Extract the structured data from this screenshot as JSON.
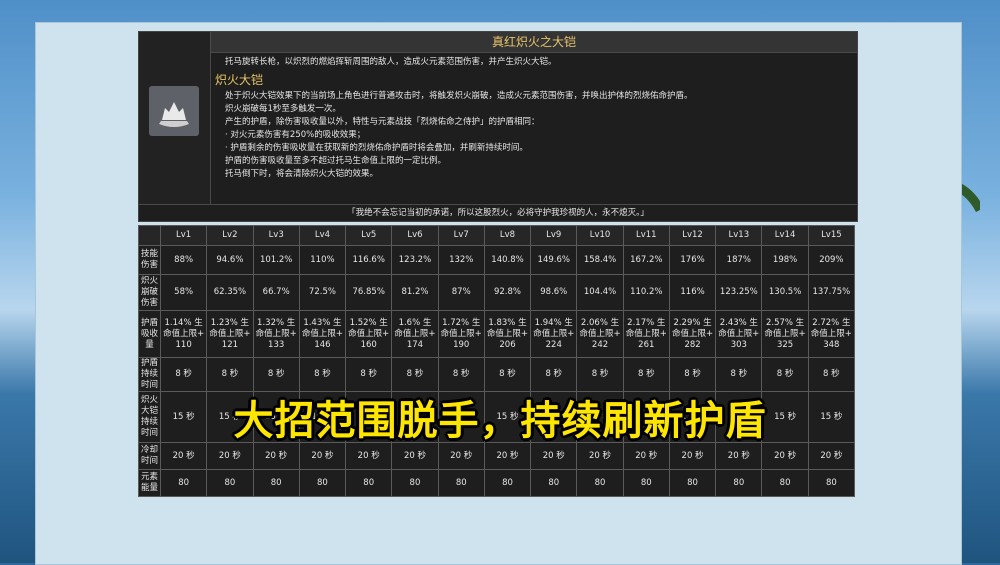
{
  "skill": {
    "name": "真红炽火之大铠",
    "intro": "托马旋转长枪，以炽烈的燃焰挥斩周围的敌人，造成火元素范围伤害，并产生炽火大铠。",
    "sub_title": "炽火大铠",
    "lines": [
      "处于炽火大铠效果下的当前场上角色进行普通攻击时，将触发炽火崩破，造成火元素范围伤害，并唤出护体的烈烧佑命护盾。",
      "炽火崩破每1秒至多触发一次。",
      "产生的护盾，除伤害吸收量以外，特性与元素战技「烈烧佑命之侍护」的护盾相同：",
      "· 对火元素伤害有250%的吸收效果；",
      "· 护盾剩余的伤害吸收量在获取新的烈烧佑命护盾时将会叠加，并刷新持续时间。",
      "护盾的伤害吸收量至多不超过托马生命值上限的一定比例。",
      "托马倒下时，将会清除炽火大铠的效果。"
    ],
    "quote": "「我绝不会忘记当初的承诺，所以这股烈火，必将守护我珍视的人，永不熄灭。」"
  },
  "table": {
    "levels": [
      "Lv1",
      "Lv2",
      "Lv3",
      "Lv4",
      "Lv5",
      "Lv6",
      "Lv7",
      "Lv8",
      "Lv9",
      "Lv10",
      "Lv11",
      "Lv12",
      "Lv13",
      "Lv14",
      "Lv15"
    ],
    "rows": [
      {
        "label": "技能伤害",
        "values": [
          "88%",
          "94.6%",
          "101.2%",
          "110%",
          "116.6%",
          "123.2%",
          "132%",
          "140.8%",
          "149.6%",
          "158.4%",
          "167.2%",
          "176%",
          "187%",
          "198%",
          "209%"
        ]
      },
      {
        "label": "炽火崩破伤害",
        "values": [
          "58%",
          "62.35%",
          "66.7%",
          "72.5%",
          "76.85%",
          "81.2%",
          "87%",
          "92.8%",
          "98.6%",
          "104.4%",
          "110.2%",
          "116%",
          "123.25%",
          "130.5%",
          "137.75%"
        ]
      },
      {
        "label": "护盾吸收量",
        "values": [
          "1.14% 生命值上限+ 110",
          "1.23% 生命值上限+ 121",
          "1.32% 生命值上限+ 133",
          "1.43% 生命值上限+ 146",
          "1.52% 生命值上限+ 160",
          "1.6% 生命值上限+ 174",
          "1.72% 生命值上限+ 190",
          "1.83% 生命值上限+ 206",
          "1.94% 生命值上限+ 224",
          "2.06% 生命值上限+ 242",
          "2.17% 生命值上限+ 261",
          "2.29% 生命值上限+ 282",
          "2.43% 生命值上限+ 303",
          "2.57% 生命值上限+ 325",
          "2.72% 生命值上限+ 348"
        ]
      },
      {
        "label": "护盾持续时间",
        "values": [
          "8 秒",
          "8 秒",
          "8 秒",
          "8 秒",
          "8 秒",
          "8 秒",
          "8 秒",
          "8 秒",
          "8 秒",
          "8 秒",
          "8 秒",
          "8 秒",
          "8 秒",
          "8 秒",
          "8 秒"
        ]
      },
      {
        "label": "炽火大铠持续时间",
        "values": [
          "15 秒",
          "15 秒",
          "15 秒",
          "15 秒",
          "15 秒",
          "15 秒",
          "15 秒",
          "15 秒",
          "15 秒",
          "15 秒",
          "15 秒",
          "15 秒",
          "15 秒",
          "15 秒",
          "15 秒"
        ]
      },
      {
        "label": "冷却时间",
        "values": [
          "20 秒",
          "20 秒",
          "20 秒",
          "20 秒",
          "20 秒",
          "20 秒",
          "20 秒",
          "20 秒",
          "20 秒",
          "20 秒",
          "20 秒",
          "20 秒",
          "20 秒",
          "20 秒",
          "20 秒"
        ]
      },
      {
        "label": "元素能量",
        "values": [
          "80",
          "80",
          "80",
          "80",
          "80",
          "80",
          "80",
          "80",
          "80",
          "80",
          "80",
          "80",
          "80",
          "80",
          "80"
        ]
      }
    ]
  },
  "caption": "大招范围脱手，持续刷新护盾",
  "icon": "skill-burst-icon",
  "colors": {
    "gold": "#e8c46a",
    "caption": "#ffe600",
    "panel": "#1e1e1e"
  }
}
